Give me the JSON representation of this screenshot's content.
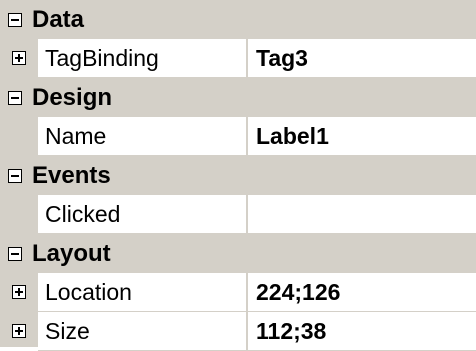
{
  "property_grid": {
    "categories": [
      {
        "label": "Data",
        "expanded": true,
        "properties": [
          {
            "name": "TagBinding",
            "value": "Tag3",
            "expandable": true
          }
        ]
      },
      {
        "label": "Design",
        "expanded": true,
        "properties": [
          {
            "name": "Name",
            "value": "Label1",
            "expandable": false
          }
        ]
      },
      {
        "label": "Events",
        "expanded": true,
        "properties": [
          {
            "name": "Clicked",
            "value": "",
            "expandable": false
          }
        ]
      },
      {
        "label": "Layout",
        "expanded": true,
        "properties": [
          {
            "name": "Location",
            "value": "224;126",
            "expandable": true
          },
          {
            "name": "Size",
            "value": "112;38",
            "expandable": true
          }
        ]
      }
    ],
    "colors": {
      "category_background": "#d4d0c8",
      "cell_background": "#ffffff",
      "text": "#000000"
    },
    "icons": {
      "expanded": "collapse-minus-icon",
      "collapsed": "expand-plus-icon"
    }
  }
}
